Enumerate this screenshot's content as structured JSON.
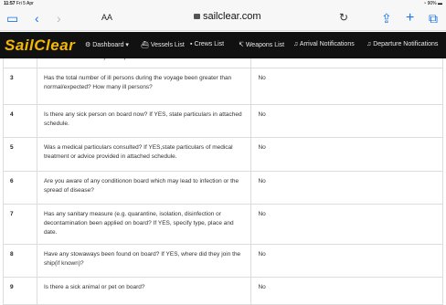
{
  "status_bar": {
    "time": "11:57",
    "date": "Fri 5 Apr",
    "battery": "90%"
  },
  "browser": {
    "text_size_label": "AA",
    "url": "sailclear.com"
  },
  "app": {
    "logo": "SailClear",
    "nav": [
      {
        "label": "Dashboard ▾",
        "icon": "dashboard-icon"
      },
      {
        "label": "Vessels List",
        "icon": "ship-icon"
      },
      {
        "label": "Crews List",
        "icon": "crew-icon"
      },
      {
        "label": "Weapons List",
        "icon": "weapon-icon"
      },
      {
        "label": "Arrival Notifications",
        "icon": "bell-icon"
      },
      {
        "label": "Departure Notifications",
        "icon": "bell-icon"
      }
    ]
  },
  "table": {
    "partial_top_text": "case of disease which you suspect to be of an infectious nature",
    "rows": [
      {
        "num": "3",
        "question": "Has the total number of ill persons during the voyage been greater than normal/expected? How many ill persons?",
        "answer": "No"
      },
      {
        "num": "4",
        "question": "Is there any sick person on board now? If YES, state particulars in attached schedule.",
        "answer": "No"
      },
      {
        "num": "5",
        "question": "Was a medical particulars consulted? If YES,state particulars of medical treatment or advice provided in attached schedule.",
        "answer": "No"
      },
      {
        "num": "6",
        "question": "Are you aware of any conditionon board which may lead to infection or the spread of disease?",
        "answer": "No"
      },
      {
        "num": "7",
        "question": "Has any sanitary measure (e.g. quarantine, isolation, disinfection or decontamination been applied on board? If YES, specify type, place and date.",
        "answer": "No"
      },
      {
        "num": "8",
        "question": "Have any stowaways been found on board? If YES, where did they join the ship(if known)?",
        "answer": "No"
      },
      {
        "num": "9",
        "question": "Is there a sick animal or pet on board?",
        "answer": "No"
      }
    ]
  }
}
